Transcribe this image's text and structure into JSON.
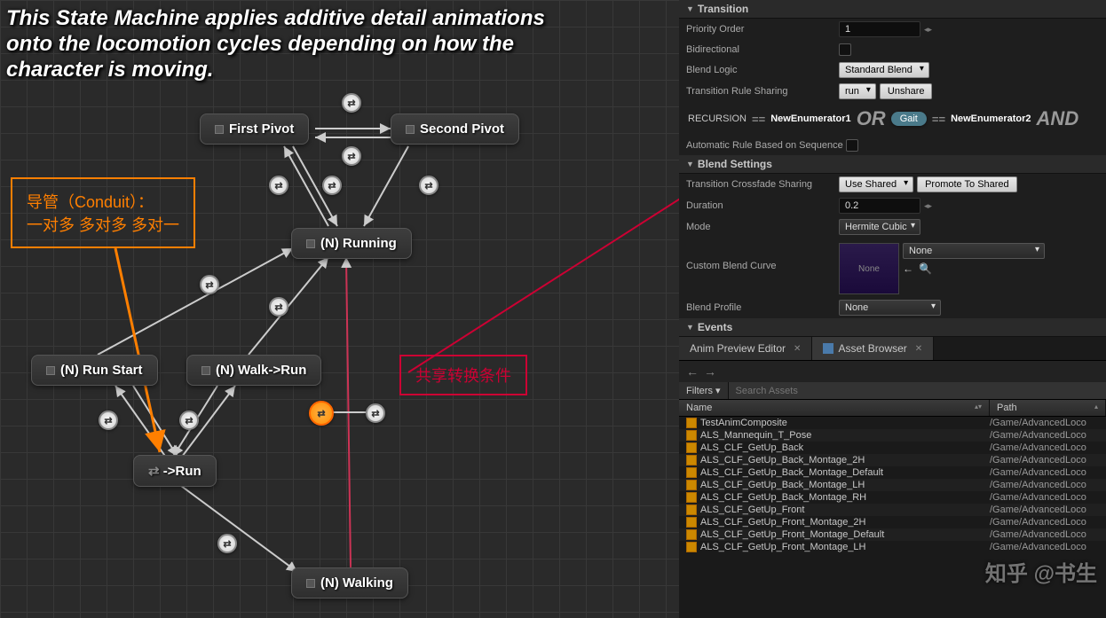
{
  "overlay": "This State Machine applies additive detail animations onto the locomotion cycles depending on how the character is moving.",
  "nodes": {
    "first_pivot": "First Pivot",
    "second_pivot": "Second Pivot",
    "running": "(N) Running",
    "run_start": "(N) Run Start",
    "walk_run": "(N) Walk->Run",
    "to_run": "->Run",
    "walking": "(N) Walking"
  },
  "callouts": {
    "conduit_title": "导管（Conduit）：",
    "conduit_sub": "一对多 多对多 多对一",
    "shared": "共享转换条件"
  },
  "details": {
    "section_transition": "Transition",
    "priority_order": {
      "label": "Priority Order",
      "value": "1"
    },
    "bidirectional": {
      "label": "Bidirectional"
    },
    "blend_logic": {
      "label": "Blend Logic",
      "value": "Standard Blend"
    },
    "trans_rule_sharing": {
      "label": "Transition Rule Sharing",
      "share": "run",
      "unshare": "Unshare"
    },
    "rule": {
      "recursion": "RECURSION",
      "enum1": "NewEnumerator1",
      "or": "OR",
      "gait": "Gait",
      "enum2": "NewEnumerator2",
      "and": "AND"
    },
    "auto_rule": {
      "label": "Automatic Rule Based on Sequence"
    },
    "section_blend": "Blend Settings",
    "crossfade_sharing": {
      "label": "Transition Crossfade Sharing",
      "value": "Use Shared",
      "promote": "Promote To Shared"
    },
    "duration": {
      "label": "Duration",
      "value": "0.2"
    },
    "mode": {
      "label": "Mode",
      "value": "Hermite Cubic"
    },
    "custom_curve": {
      "label": "Custom Blend Curve",
      "preview": "None",
      "value": "None"
    },
    "blend_profile": {
      "label": "Blend Profile",
      "value": "None"
    },
    "section_events": "Events"
  },
  "tabs": {
    "anim_preview": "Anim Preview Editor",
    "asset_browser": "Asset Browser"
  },
  "browser": {
    "filters": "Filters",
    "search_placeholder": "Search Assets",
    "col_name": "Name",
    "col_path": "Path",
    "rows": [
      {
        "name": "TestAnimComposite",
        "path": "/Game/AdvancedLoco"
      },
      {
        "name": "ALS_Mannequin_T_Pose",
        "path": "/Game/AdvancedLoco"
      },
      {
        "name": "ALS_CLF_GetUp_Back",
        "path": "/Game/AdvancedLoco"
      },
      {
        "name": "ALS_CLF_GetUp_Back_Montage_2H",
        "path": "/Game/AdvancedLoco"
      },
      {
        "name": "ALS_CLF_GetUp_Back_Montage_Default",
        "path": "/Game/AdvancedLoco"
      },
      {
        "name": "ALS_CLF_GetUp_Back_Montage_LH",
        "path": "/Game/AdvancedLoco"
      },
      {
        "name": "ALS_CLF_GetUp_Back_Montage_RH",
        "path": "/Game/AdvancedLoco"
      },
      {
        "name": "ALS_CLF_GetUp_Front",
        "path": "/Game/AdvancedLoco"
      },
      {
        "name": "ALS_CLF_GetUp_Front_Montage_2H",
        "path": "/Game/AdvancedLoco"
      },
      {
        "name": "ALS_CLF_GetUp_Front_Montage_Default",
        "path": "/Game/AdvancedLoco"
      },
      {
        "name": "ALS_CLF_GetUp_Front_Montage_LH",
        "path": "/Game/AdvancedLoco"
      }
    ]
  },
  "watermark": "知乎 @书生"
}
